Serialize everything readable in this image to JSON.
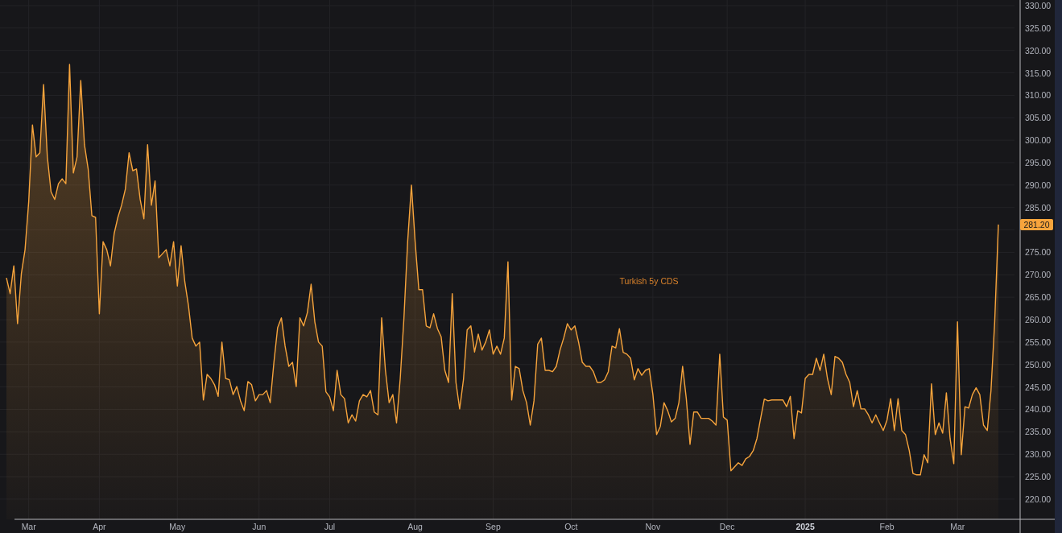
{
  "chart": {
    "price_label": "281.20",
    "chart_data": {
      "type": "area",
      "grid": true,
      "ylim": [
        215.5,
        331.25
      ],
      "categories": [
        null,
        null,
        null,
        null,
        null,
        null,
        "Mar",
        null,
        null,
        null,
        null,
        null,
        null,
        null,
        null,
        null,
        null,
        null,
        null,
        null,
        null,
        null,
        null,
        null,
        null,
        "Apr",
        null,
        null,
        null,
        null,
        null,
        null,
        null,
        null,
        null,
        null,
        null,
        null,
        null,
        null,
        null,
        null,
        null,
        null,
        null,
        null,
        "May",
        null,
        null,
        null,
        null,
        null,
        null,
        null,
        null,
        null,
        null,
        null,
        null,
        null,
        null,
        null,
        null,
        null,
        null,
        null,
        null,
        null,
        "Jun",
        null,
        null,
        null,
        null,
        null,
        null,
        null,
        null,
        null,
        null,
        null,
        null,
        null,
        null,
        null,
        null,
        null,
        null,
        "Jul",
        null,
        null,
        null,
        null,
        null,
        null,
        null,
        null,
        null,
        null,
        null,
        null,
        null,
        null,
        null,
        null,
        null,
        null,
        null,
        null,
        null,
        null,
        "Aug",
        null,
        null,
        null,
        null,
        null,
        null,
        null,
        null,
        null,
        null,
        null,
        null,
        null,
        null,
        null,
        null,
        null,
        null,
        null,
        null,
        "Sep",
        null,
        null,
        null,
        null,
        null,
        null,
        null,
        null,
        null,
        null,
        null,
        null,
        null,
        null,
        null,
        null,
        null,
        null,
        null,
        null,
        "Oct",
        null,
        null,
        null,
        null,
        null,
        null,
        null,
        null,
        null,
        null,
        null,
        null,
        null,
        null,
        null,
        null,
        null,
        null,
        null,
        null,
        null,
        "Nov",
        null,
        null,
        null,
        null,
        null,
        null,
        null,
        null,
        null,
        null,
        null,
        null,
        null,
        null,
        null,
        null,
        null,
        null,
        null,
        "Dec",
        null,
        null,
        null,
        null,
        null,
        null,
        null,
        null,
        null,
        null,
        null,
        null,
        null,
        null,
        null,
        null,
        null,
        null,
        null,
        null,
        "2025",
        null,
        null,
        null,
        null,
        null,
        null,
        null,
        null,
        null,
        null,
        null,
        null,
        null,
        null,
        null,
        null,
        null,
        null,
        null,
        null,
        null,
        "Feb",
        null,
        null,
        null,
        null,
        null,
        null,
        null,
        null,
        null,
        null,
        null,
        null,
        null,
        null,
        null,
        null,
        null,
        null,
        "Mar",
        null,
        null,
        null,
        null,
        null,
        null,
        null,
        null,
        null,
        null,
        null
      ],
      "yticks": [
        {
          "value": 220,
          "label": "220.00"
        },
        {
          "value": 225,
          "label": "225.00"
        },
        {
          "value": 230,
          "label": "230.00"
        },
        {
          "value": 235,
          "label": "235.00"
        },
        {
          "value": 240,
          "label": "240.00"
        },
        {
          "value": 245,
          "label": "245.00"
        },
        {
          "value": 250,
          "label": "250.00"
        },
        {
          "value": 255,
          "label": "255.00"
        },
        {
          "value": 260,
          "label": "260.00"
        },
        {
          "value": 265,
          "label": "265.00"
        },
        {
          "value": 270,
          "label": "270.00"
        },
        {
          "value": 275,
          "label": "275.00"
        },
        {
          "value": 285,
          "label": "285.00"
        },
        {
          "value": 290,
          "label": "290.00"
        },
        {
          "value": 295,
          "label": "295.00"
        },
        {
          "value": 300,
          "label": "300.00"
        },
        {
          "value": 305,
          "label": "305.00"
        },
        {
          "value": 310,
          "label": "310.00"
        },
        {
          "value": 315,
          "label": "315.00"
        },
        {
          "value": 320,
          "label": "320.00"
        },
        {
          "value": 325,
          "label": "325.00"
        },
        {
          "value": 330,
          "label": "330.00"
        }
      ],
      "series": [
        {
          "name": "Turkish 5y CDS",
          "color": "#f7a43c",
          "values": [
            269.3,
            265.8,
            272.0,
            259.1,
            270.2,
            275.6,
            286.4,
            303.4,
            296.3,
            297.2,
            312.4,
            296.3,
            288.5,
            286.8,
            290.3,
            291.4,
            290.3,
            316.9,
            292.7,
            296.3,
            313.3,
            299.0,
            293.6,
            283.2,
            282.8,
            261.3,
            277.4,
            275.6,
            272.0,
            279.2,
            282.8,
            285.5,
            289.1,
            297.2,
            293.2,
            293.6,
            286.8,
            282.5,
            299.0,
            285.5,
            290.9,
            273.8,
            274.7,
            275.6,
            272.0,
            277.4,
            267.5,
            276.5,
            268.5,
            263.1,
            255.9,
            254.1,
            255.0,
            242.1,
            247.8,
            246.9,
            245.5,
            242.9,
            255.0,
            246.9,
            246.6,
            243.3,
            245.1,
            241.9,
            239.7,
            246.2,
            245.5,
            241.9,
            243.3,
            243.3,
            244.2,
            241.5,
            250.5,
            258.2,
            260.4,
            254.1,
            249.6,
            250.5,
            245.1,
            260.4,
            258.6,
            261.6,
            267.9,
            259.5,
            255.0,
            254.1,
            243.9,
            242.8,
            239.7,
            248.7,
            243.3,
            242.4,
            237.0,
            238.8,
            237.4,
            241.9,
            243.3,
            242.8,
            244.2,
            239.4,
            238.8,
            260.4,
            248.7,
            241.5,
            243.3,
            237.0,
            246.9,
            260.4,
            277.4,
            290.0,
            277.4,
            266.7,
            266.7,
            258.6,
            258.2,
            261.3,
            258.0,
            256.2,
            248.7,
            246.0,
            265.8,
            246.0,
            240.1,
            246.6,
            257.7,
            258.6,
            252.8,
            256.8,
            253.2,
            255.0,
            257.7,
            252.3,
            254.1,
            252.3,
            255.9,
            272.9,
            242.1,
            249.6,
            249.1,
            244.2,
            241.5,
            236.5,
            241.9,
            254.5,
            255.9,
            248.7,
            248.7,
            248.4,
            249.6,
            253.2,
            255.9,
            259.1,
            257.7,
            258.6,
            255.0,
            250.5,
            249.6,
            249.6,
            248.4,
            246.0,
            246.0,
            246.6,
            248.4,
            254.1,
            253.7,
            258.0,
            252.7,
            252.3,
            251.4,
            246.6,
            249.1,
            247.6,
            248.7,
            249.1,
            243.3,
            234.4,
            236.2,
            241.5,
            239.7,
            237.2,
            238.0,
            241.5,
            249.6,
            242.4,
            232.2,
            239.4,
            239.4,
            238.0,
            238.0,
            238.0,
            237.4,
            236.5,
            252.3,
            238.3,
            237.6,
            226.3,
            227.2,
            228.1,
            227.5,
            229.0,
            229.5,
            230.8,
            233.5,
            238.0,
            242.3,
            241.9,
            242.1,
            242.1,
            242.1,
            242.1,
            240.6,
            242.9,
            233.5,
            239.7,
            239.2,
            246.9,
            247.8,
            247.8,
            251.4,
            248.7,
            252.3,
            246.9,
            243.3,
            251.8,
            251.4,
            250.5,
            247.8,
            246.0,
            240.6,
            244.2,
            240.1,
            240.1,
            238.8,
            237.0,
            238.8,
            237.0,
            235.3,
            237.6,
            242.4,
            235.3,
            242.4,
            235.3,
            234.4,
            230.8,
            225.7,
            225.4,
            225.4,
            229.9,
            228.1,
            245.7,
            234.4,
            237.0,
            234.7,
            243.7,
            233.5,
            227.9,
            259.5,
            229.9,
            240.6,
            240.3,
            243.3,
            244.8,
            243.3,
            236.5,
            235.3,
            244.2,
            259.5,
            281.2
          ]
        }
      ]
    }
  }
}
